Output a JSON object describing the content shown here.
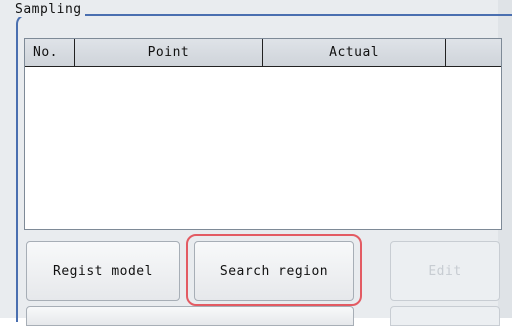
{
  "group": {
    "title": "Sampling"
  },
  "list": {
    "columns": [
      "No.",
      "Point",
      "Actual",
      ""
    ],
    "rows": []
  },
  "buttons": {
    "regist_model": "Regist model",
    "search_region": "Search region",
    "edit": "Edit"
  },
  "colors": {
    "group_border": "#4a6fb0",
    "highlight": "#e35b63"
  }
}
